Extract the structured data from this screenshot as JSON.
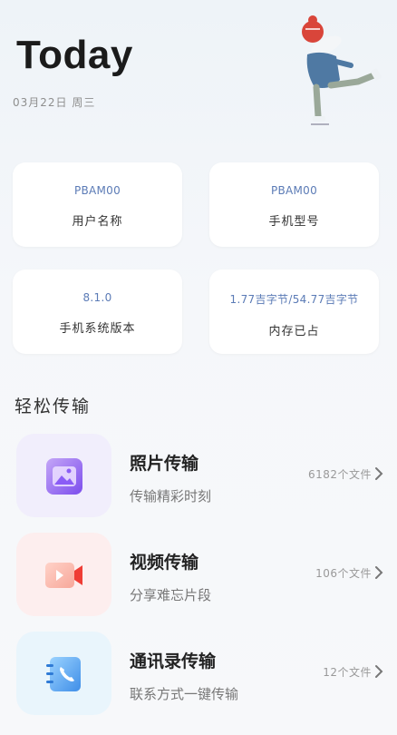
{
  "header": {
    "title": "Today",
    "date": "03月22日  周三"
  },
  "cards": [
    {
      "value": "PBAM00",
      "label": "用户名称"
    },
    {
      "value": "PBAM00",
      "label": "手机型号"
    },
    {
      "value": "8.1.0",
      "label": "手机系统版本"
    },
    {
      "value": "1.77吉字节/54.77吉字节",
      "label": "内存已占"
    }
  ],
  "transfer": {
    "section_title": "轻松传输",
    "items": [
      {
        "title": "照片传输",
        "subtitle": "传输精彩时刻",
        "count": "6182个文件",
        "icon": "photo-icon",
        "color": "#8b5cf6"
      },
      {
        "title": "视频传输",
        "subtitle": "分享难忘片段",
        "count": "106个文件",
        "icon": "video-icon",
        "color": "#f06a5e"
      },
      {
        "title": "通讯录传输",
        "subtitle": "联系方式一键传输",
        "count": "12个文件",
        "icon": "contacts-icon",
        "color": "#3f8ee8"
      }
    ]
  }
}
